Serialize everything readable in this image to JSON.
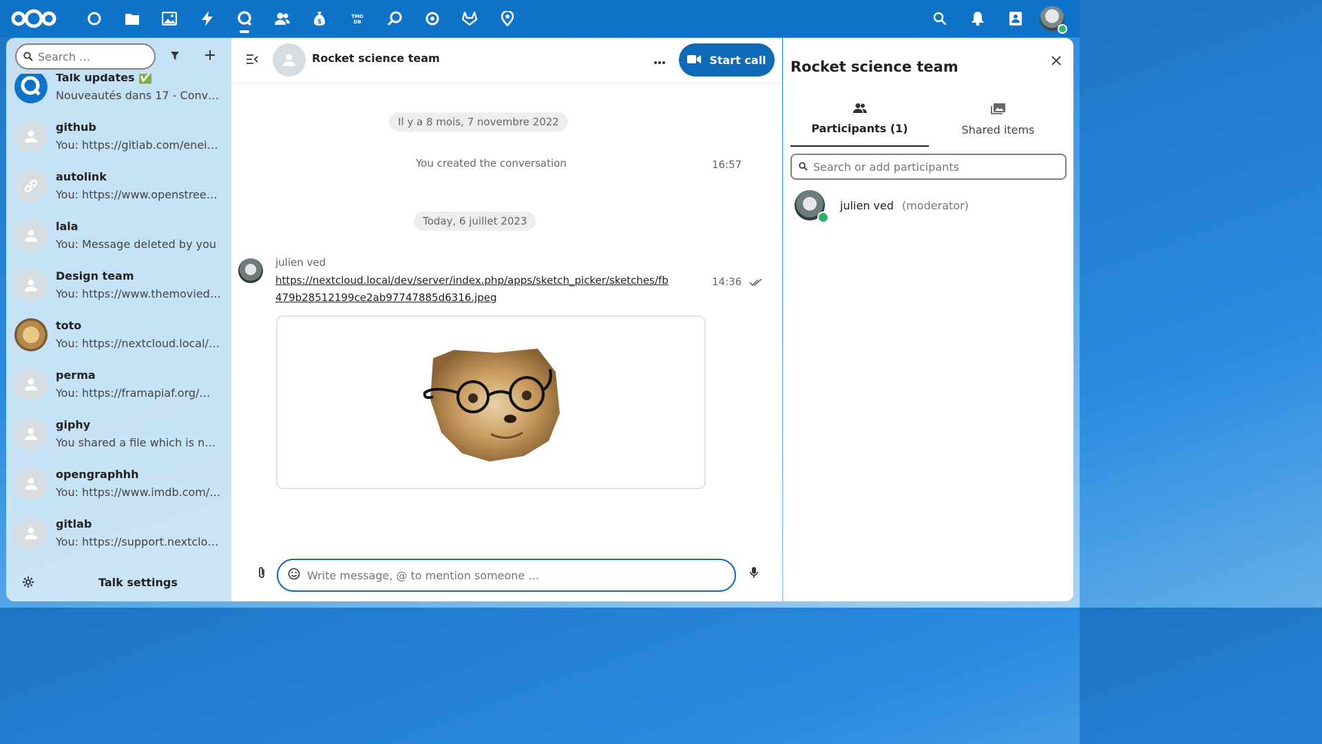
{
  "topbar": {
    "apps": [
      {
        "name": "dashboard-icon"
      },
      {
        "name": "files-icon"
      },
      {
        "name": "photos-icon"
      },
      {
        "name": "activity-icon"
      },
      {
        "name": "talk-icon",
        "active": true
      },
      {
        "name": "contacts-icon"
      },
      {
        "name": "money-icon"
      },
      {
        "name": "tmdb-icon"
      },
      {
        "name": "search-app-icon"
      },
      {
        "name": "circle-app-icon"
      },
      {
        "name": "gitlab-icon"
      },
      {
        "name": "maps-icon"
      }
    ],
    "right_icons": [
      "search-icon",
      "notifications-icon",
      "contacts-menu-icon"
    ],
    "accent": "#0f74c9"
  },
  "sidebar": {
    "search_placeholder": "Search …",
    "conversations": [
      {
        "name": "Talk updates ✅",
        "message": "Nouveautés dans 17 - Conver…"
      },
      {
        "name": "github",
        "message": "You: https://gitlab.com/eneil…"
      },
      {
        "name": "autolink",
        "message": "You: https://www.openstreet…"
      },
      {
        "name": "lala",
        "message": "You: Message deleted by you"
      },
      {
        "name": "Design team",
        "message": "You: https://www.themovied…"
      },
      {
        "name": "toto",
        "message": "You: https://nextcloud.local/…"
      },
      {
        "name": "perma",
        "message": "You: https://framapiaf.org/@…"
      },
      {
        "name": "giphy",
        "message": "You shared a file which is no l…"
      },
      {
        "name": "opengraphhh",
        "message": "You: https://www.imdb.com/…"
      },
      {
        "name": "gitlab",
        "message": "You: https://support.nextclou…"
      }
    ],
    "settings_label": "Talk settings"
  },
  "chat": {
    "title": "Rocket science team",
    "start_call_label": "Start call",
    "date_1": "Il y a 8 mois, 7 novembre 2022",
    "system_message": "You created the conversation",
    "system_time": "16:57",
    "date_2": "Today, 6 juillet 2023",
    "message": {
      "author": "julien ved",
      "text": "https://nextcloud.local/dev/server/index.php/apps/sketch_picker/sketches/fb479b28512199ce2ab97747885d6316.jpeg",
      "time": "14:36"
    },
    "composer_placeholder": "Write message, @ to mention someone …"
  },
  "panel": {
    "title": "Rocket science team",
    "tabs": [
      {
        "label": "Participants (1)",
        "active": true
      },
      {
        "label": "Shared items",
        "active": false
      }
    ],
    "search_placeholder": "Search or add participants",
    "participants": [
      {
        "name": "julien ved",
        "role": "(moderator)",
        "status": "online"
      }
    ]
  }
}
